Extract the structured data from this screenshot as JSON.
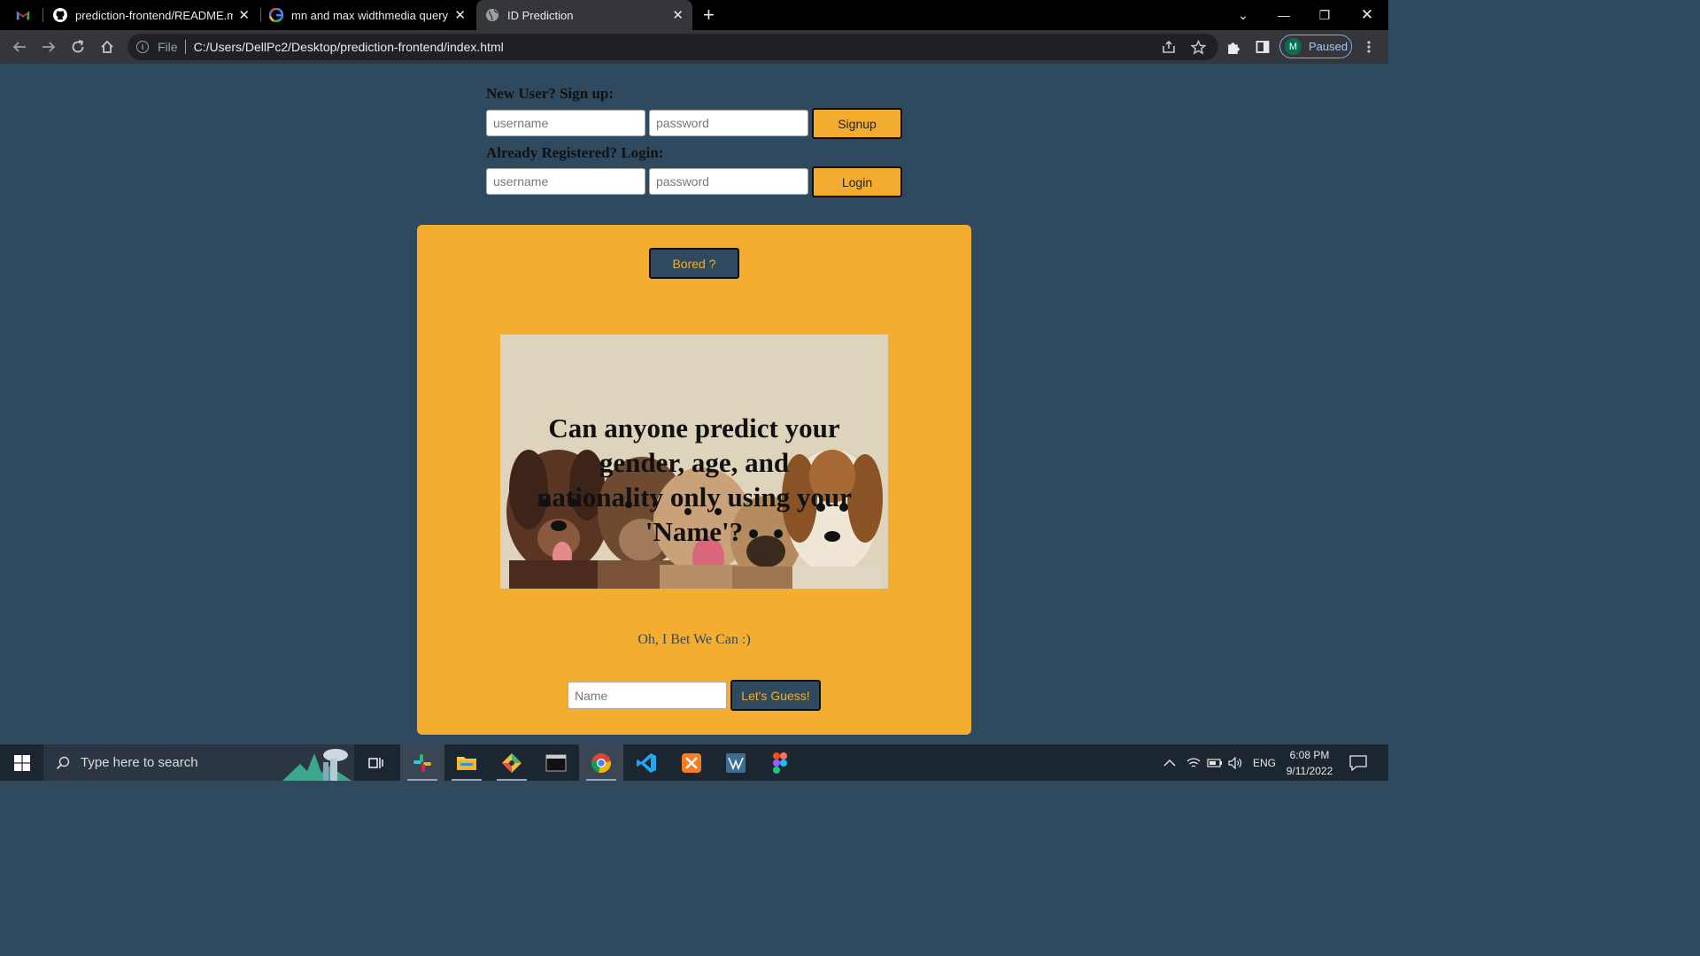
{
  "browser": {
    "tabs": [
      {
        "title": "prediction-frontend/README.md",
        "icon": "github-icon"
      },
      {
        "title": "mn and max widthmedia query -",
        "icon": "google-icon"
      },
      {
        "title": "ID Prediction",
        "icon": "globe-icon",
        "active": true
      }
    ],
    "new_tab": "+",
    "address": {
      "scheme_label": "File",
      "url": "C:/Users/DellPc2/Desktop/prediction-frontend/index.html"
    },
    "profile": {
      "initial": "M",
      "status": "Paused"
    }
  },
  "page": {
    "signup": {
      "heading": "New User? Sign up:",
      "username_placeholder": "username",
      "password_placeholder": "password",
      "button": "Signup"
    },
    "login": {
      "heading": "Already Registered? Login:",
      "username_placeholder": "username",
      "password_placeholder": "password",
      "button": "Login"
    },
    "card": {
      "bored_button": "Bored ?",
      "hero_text": "Can anyone predict your gender, age, and nationality only using your 'Name'?",
      "tagline": "Oh, I Bet We Can :)",
      "name_placeholder": "Name",
      "guess_button": "Let's Guess!"
    },
    "colors": {
      "background": "#2f4a5e",
      "accent": "#f4ad2e"
    }
  },
  "taskbar": {
    "search_placeholder": "Type here to search",
    "language": "ENG",
    "time": "6:08 PM",
    "date": "9/11/2022"
  }
}
